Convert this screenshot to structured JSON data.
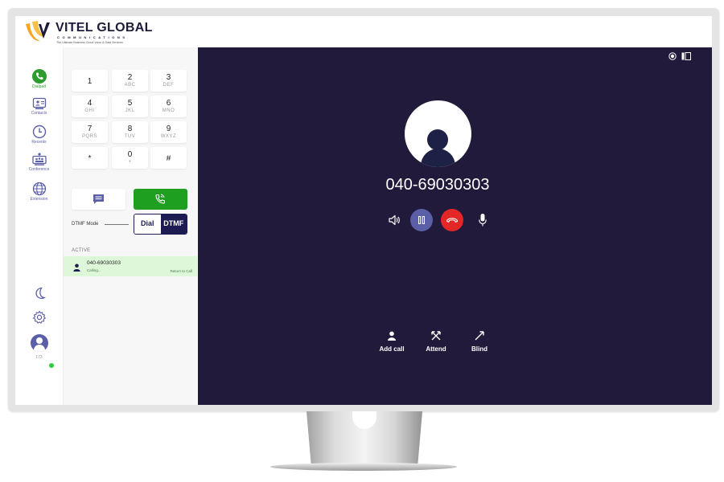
{
  "app": {
    "logo_title": "VITEL GLOBAL",
    "logo_subtitle": "COMMUNICATIONS",
    "logo_tagline": "The Ultimate Business Cloud Voice & Data Services"
  },
  "nav": {
    "items": [
      {
        "label": "Dialpad",
        "icon": "phone-icon"
      },
      {
        "label": "Contacts",
        "icon": "contacts-icon"
      },
      {
        "label": "Recents",
        "icon": "clock-icon"
      },
      {
        "label": "Conference",
        "icon": "conference-icon"
      },
      {
        "label": "Extension",
        "icon": "globe-icon"
      }
    ],
    "extension": "173"
  },
  "keypad": {
    "keys": [
      {
        "digit": "1",
        "letters": ""
      },
      {
        "digit": "2",
        "letters": "ABC"
      },
      {
        "digit": "3",
        "letters": "DEF"
      },
      {
        "digit": "4",
        "letters": "GHI"
      },
      {
        "digit": "5",
        "letters": "JKL"
      },
      {
        "digit": "6",
        "letters": "MNO"
      },
      {
        "digit": "7",
        "letters": "PQRS"
      },
      {
        "digit": "8",
        "letters": "TUV"
      },
      {
        "digit": "9",
        "letters": "WXYZ"
      },
      {
        "digit": "*",
        "letters": ""
      },
      {
        "digit": "0",
        "letters": "+"
      },
      {
        "digit": "#",
        "letters": ""
      }
    ]
  },
  "dtmf": {
    "label": "DTMF Mode",
    "option_dial": "Dial",
    "option_dtmf": "DTMF",
    "selected": "DTMF"
  },
  "active_calls": {
    "header": "ACTIVE",
    "items": [
      {
        "number": "040-69030303",
        "status": "Calling...",
        "action": "Return to Call"
      }
    ]
  },
  "call": {
    "number": "040-69030303",
    "actions": [
      {
        "label": "Add call",
        "icon": "add-user-icon"
      },
      {
        "label": "Attend",
        "icon": "attended-transfer-icon"
      },
      {
        "label": "Blind",
        "icon": "blind-transfer-icon"
      }
    ]
  },
  "colors": {
    "brand_navy": "#1c1c52",
    "accent_purple": "#5b5fa8",
    "call_green": "#1f9f1f",
    "hangup_red": "#e32626",
    "call_background": "#211a3a",
    "active_row": "#dff7d9",
    "logo_orange": "#f5a623"
  }
}
